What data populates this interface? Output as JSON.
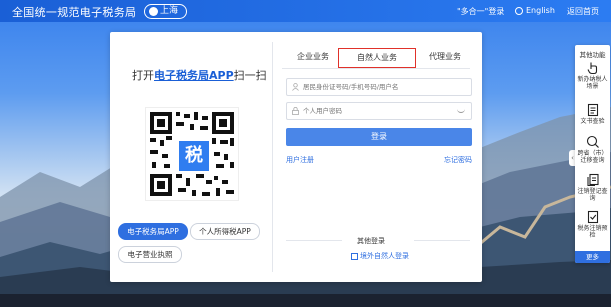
{
  "header": {
    "site_title": "全国统一规范电子税务局",
    "region": "上海",
    "login_link": "\"多合一\"登录",
    "language": "English",
    "home": "返回首页"
  },
  "qr_panel": {
    "title_prefix": "打开",
    "title_highlight": "电子税务局APP",
    "title_suffix": "扫一扫",
    "qr_logo_char": "税",
    "apps": [
      "电子税务局APP",
      "个人所得税APP",
      "电子营业执照"
    ]
  },
  "login": {
    "tabs": [
      "企业业务",
      "自然人业务",
      "代理业务"
    ],
    "active_tab": "自然人业务",
    "account_placeholder": "居民身份证号码/手机号码/用户名",
    "password_placeholder": "个人用户密码",
    "login_button": "登录",
    "register": "用户注册",
    "forgot": "忘记密码",
    "other_login": "其他登录",
    "overseas_login": "境外自然人登录"
  },
  "side_panel": {
    "header": "其他功能",
    "items": [
      {
        "label": "新办纳税人场景",
        "icon": "hand-pointer-icon"
      },
      {
        "label": "文书查验",
        "icon": "document-icon"
      },
      {
        "label": "跨省（市）迁移查询",
        "icon": "search-icon"
      },
      {
        "label": "注销登记查询",
        "icon": "copy-document-icon"
      },
      {
        "label": "税务注销预检",
        "icon": "check-document-icon"
      }
    ],
    "more": "更多"
  },
  "colors": {
    "brand_blue": "#1a5fd6",
    "button_blue": "#4a86e8",
    "active_tab_border": "#e0312a"
  }
}
